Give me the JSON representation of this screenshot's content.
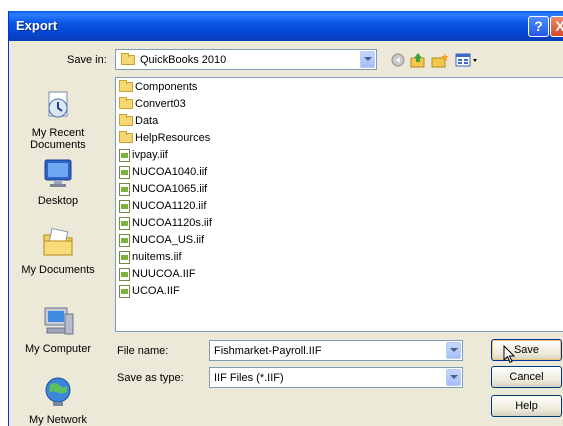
{
  "window": {
    "title": "Export",
    "help_button": "?",
    "close_button": "X"
  },
  "save_in": {
    "label": "Save in:",
    "value": "QuickBooks 2010"
  },
  "toolbar_icons": [
    "back-icon",
    "up-folder-icon",
    "new-folder-icon",
    "views-menu-icon"
  ],
  "places": [
    {
      "label": "My Recent\nDocuments",
      "icon": "recent-documents-icon"
    },
    {
      "label": "Desktop",
      "icon": "desktop-icon"
    },
    {
      "label": "My Documents",
      "icon": "my-documents-icon"
    },
    {
      "label": "My Computer",
      "icon": "my-computer-icon"
    },
    {
      "label": "My Network",
      "icon": "my-network-icon"
    }
  ],
  "files": [
    {
      "name": "Components",
      "type": "folder"
    },
    {
      "name": "Convert03",
      "type": "folder"
    },
    {
      "name": "Data",
      "type": "folder"
    },
    {
      "name": "HelpResources",
      "type": "folder"
    },
    {
      "name": "ivpay.iif",
      "type": "file"
    },
    {
      "name": "NUCOA1040.iif",
      "type": "file"
    },
    {
      "name": "NUCOA1065.iif",
      "type": "file"
    },
    {
      "name": "NUCOA1120.iif",
      "type": "file"
    },
    {
      "name": "NUCOA1120s.iif",
      "type": "file"
    },
    {
      "name": "NUCOA_US.iif",
      "type": "file"
    },
    {
      "name": "nuitems.iif",
      "type": "file"
    },
    {
      "name": "NUUCOA.IIF",
      "type": "file"
    },
    {
      "name": "UCOA.IIF",
      "type": "file"
    }
  ],
  "file_name": {
    "label": "File name:",
    "value": "Fishmarket-Payroll.IIF"
  },
  "save_as_type": {
    "label": "Save as type:",
    "value": "IIF Files (*.IIF)"
  },
  "buttons": {
    "save": "Save",
    "cancel": "Cancel",
    "help": "Help"
  },
  "colors": {
    "title_bar": "#0b56e3",
    "dialog_bg": "#ece9d8"
  }
}
